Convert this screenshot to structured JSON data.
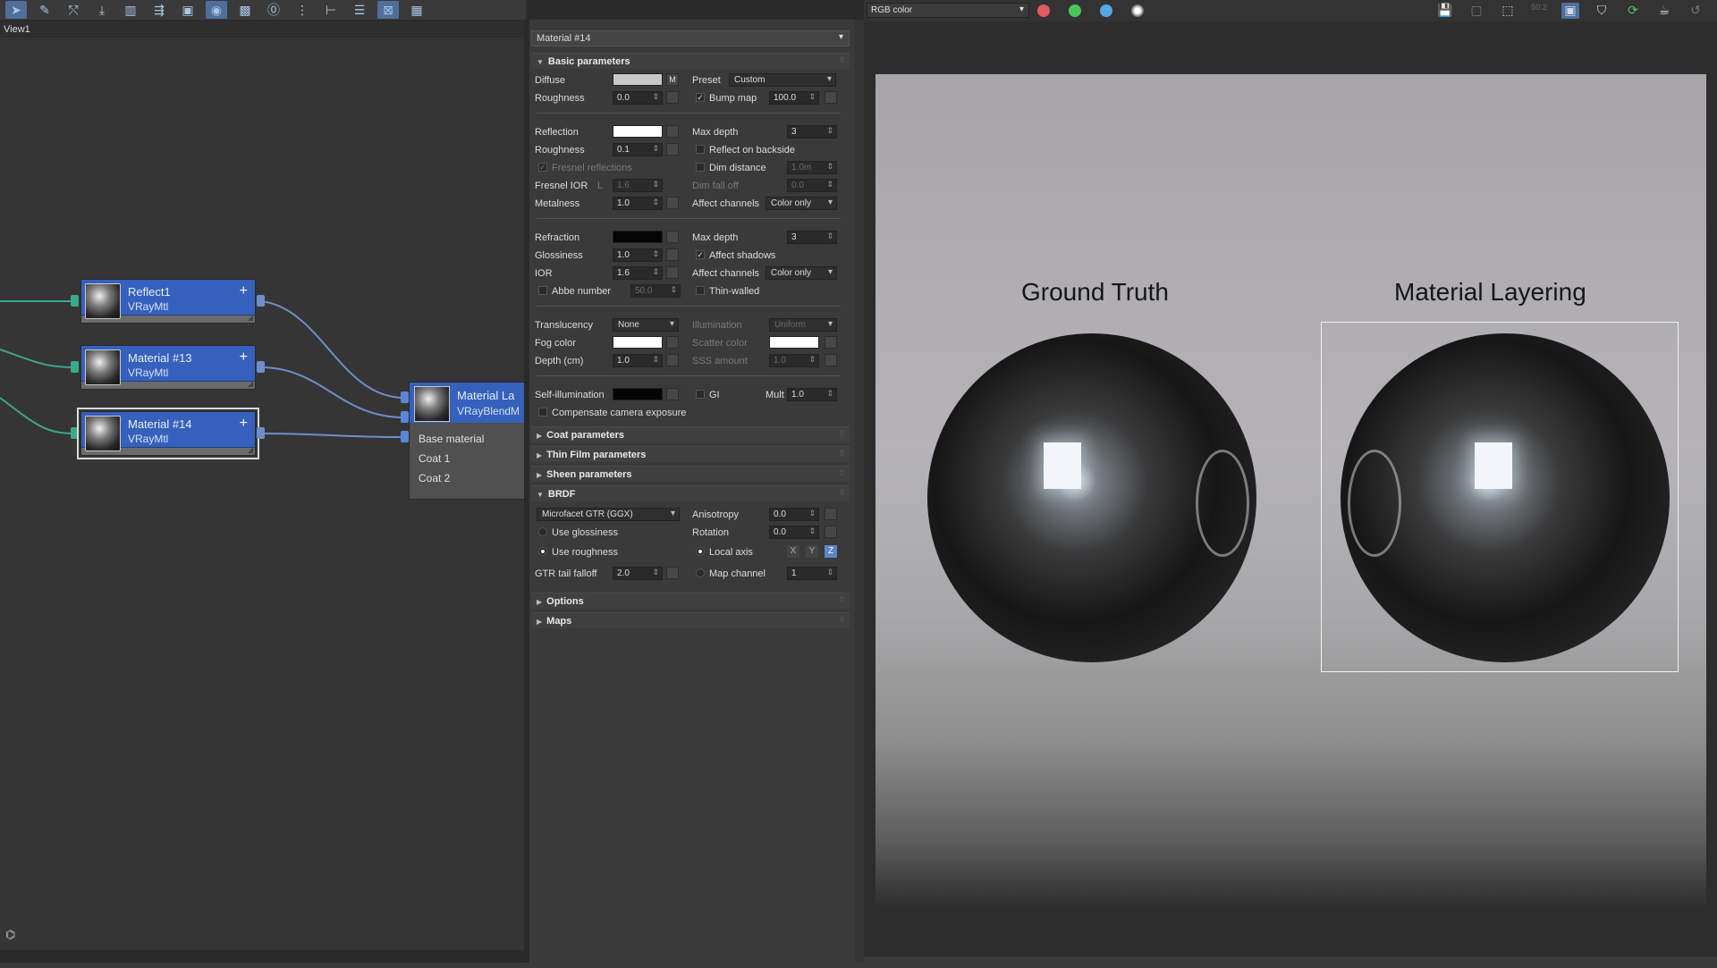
{
  "node_editor": {
    "view_tab": "View1",
    "toolbar_icons": [
      "select-icon",
      "pencil-icon",
      "link-icon",
      "move-icon",
      "trash-icon",
      "layout-icon",
      "material-icon",
      "sphere-icon",
      "grid-icon",
      "counter-icon",
      "align-icon",
      "branch-icon",
      "list-icon",
      "checker-icon",
      "pattern-icon"
    ],
    "nodes": [
      {
        "title": "Reflect1",
        "type": "VRayMtl",
        "selected": false
      },
      {
        "title": "Material #13",
        "type": "VRayMtl",
        "selected": false
      },
      {
        "title": "Material #14",
        "type": "VRayMtl",
        "selected": true
      }
    ],
    "blend_node": {
      "title": "Material La",
      "type": "VRayBlendM",
      "slots": [
        "Base material",
        "Coat 1",
        "Coat 2"
      ]
    },
    "colors": {
      "node_head": "#3561bd",
      "wire_green": "#3ca88c",
      "wire_blue": "#6f8ec9"
    }
  },
  "props": {
    "material_name": "Material #14",
    "rollouts": {
      "basic": "Basic parameters",
      "coat": "Coat parameters",
      "thin_film": "Thin Film parameters",
      "sheen": "Sheen parameters",
      "brdf": "BRDF",
      "options": "Options",
      "maps": "Maps"
    },
    "diffuse": {
      "label": "Diffuse",
      "m": "M",
      "preset_label": "Preset",
      "preset_value": "Custom"
    },
    "roughness1": {
      "label": "Roughness",
      "value": "0.0",
      "bump_label": "Bump map",
      "bump_value": "100.0"
    },
    "reflection": {
      "label": "Reflection",
      "maxdepth_label": "Max depth",
      "maxdepth_value": "3"
    },
    "roughness2": {
      "label": "Roughness",
      "value": "0.1",
      "backside_label": "Reflect on backside"
    },
    "fresnel": {
      "label": "Fresnel reflections",
      "dim_distance": "Dim distance",
      "dim_distance_value": "1.0m"
    },
    "fresnel_ior": {
      "label": "Fresnel IOR",
      "l": "L",
      "value": "1.6",
      "dim_falloff": "Dim fall off",
      "dim_falloff_value": "0.0"
    },
    "metalness": {
      "label": "Metalness",
      "value": "1.0",
      "affect_channels": "Affect channels",
      "affect_value": "Color only"
    },
    "refraction": {
      "label": "Refraction",
      "maxdepth_label": "Max depth",
      "maxdepth_value": "3"
    },
    "glossiness": {
      "label": "Glossiness",
      "value": "1.0",
      "affect_shadows": "Affect shadows"
    },
    "ior": {
      "label": "IOR",
      "value": "1.6",
      "affect_channels": "Affect channels",
      "affect_value": "Color only"
    },
    "abbe": {
      "label": "Abbe number",
      "value": "50.0",
      "thin_walled": "Thin-walled"
    },
    "translucency": {
      "label": "Translucency",
      "value": "None",
      "illumination": "Illumination",
      "illumination_value": "Uniform"
    },
    "fog": {
      "label": "Fog color",
      "scatter_label": "Scatter color"
    },
    "depth": {
      "label": "Depth (cm)",
      "value": "1.0",
      "sss_label": "SSS amount",
      "sss_value": "1.0"
    },
    "selfillum": {
      "label": "Self-illumination",
      "gi": "GI",
      "mult_label": "Mult",
      "mult_value": "1.0"
    },
    "compensate": "Compensate camera exposure",
    "brdf": {
      "type": "Microfacet GTR (GGX)",
      "anisotropy_label": "Anisotropy",
      "anisotropy_value": "0.0",
      "use_glossiness": "Use glossiness",
      "rotation_label": "Rotation",
      "rotation_value": "0.0",
      "use_roughness": "Use roughness",
      "local_axis": "Local axis",
      "x": "X",
      "y": "Y",
      "z": "Z",
      "gtr_label": "GTR tail falloff",
      "gtr_value": "2.0",
      "map_channel": "Map channel",
      "map_channel_value": "1"
    }
  },
  "vfb": {
    "channel": "RGB color",
    "dot_colors": {
      "red": "#e05c5c",
      "green": "#4cc45a",
      "blue": "#57a8e6"
    },
    "icons": [
      "save-icon",
      "copy-icon",
      "region-icon",
      "lens-icon",
      "frame-icon",
      "shield-icon",
      "refresh-icon",
      "teapot-icon",
      "undo-icon"
    ],
    "caption_left": "Ground Truth",
    "caption_right": "Material Layering"
  }
}
